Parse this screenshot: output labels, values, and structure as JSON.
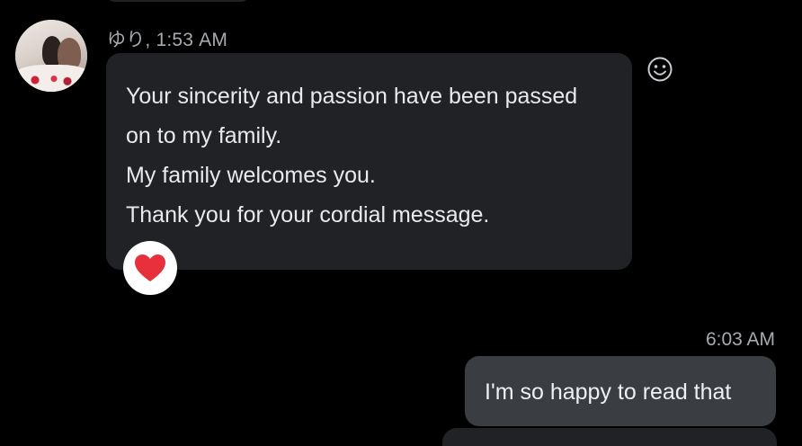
{
  "incoming": {
    "sender_meta": "ゆり, 1:53 AM",
    "lines": [
      "Your sincerity and passion have been passed",
      "on to my family.",
      "My family welcomes you.",
      "Thank you for your cordial message."
    ],
    "reaction_icon": "heart-emoji",
    "reaction_color": "#e8303d",
    "avatar_icon": "user-avatar-photo",
    "bubble_color": "#202226"
  },
  "react_button": {
    "icon": "smiley-add-reaction-icon"
  },
  "outgoing": {
    "time": "6:03 AM",
    "text": "I'm so happy to read that",
    "bubble_color": "#3a3d42"
  },
  "colors": {
    "background": "#000000",
    "meta_text": "#a7aaae",
    "body_text": "#e9eaec"
  }
}
